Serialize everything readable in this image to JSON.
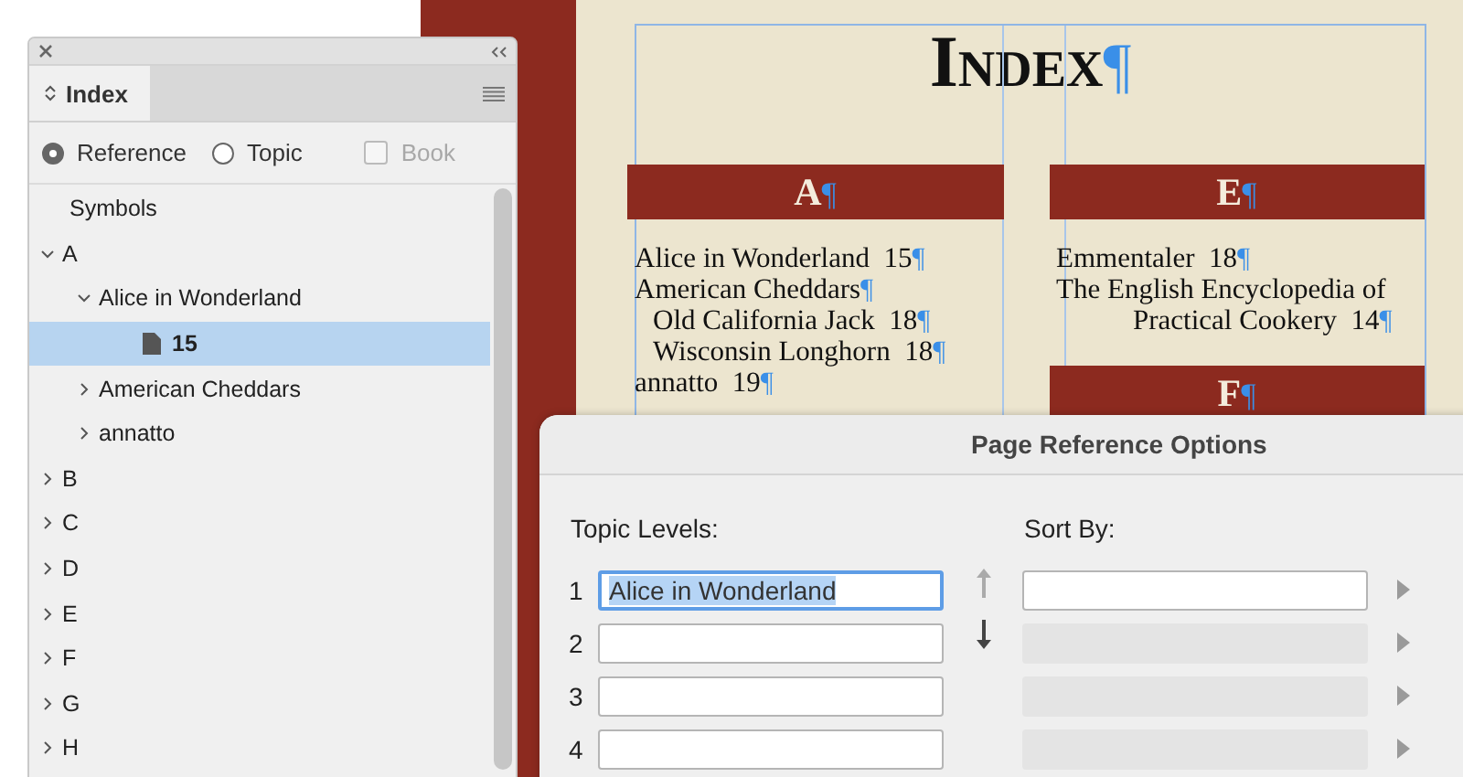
{
  "document": {
    "title": "Index",
    "pilcrow": "¶",
    "columns": [
      {
        "sections": [
          {
            "letter": "A",
            "entries": [
              {
                "text": "Alice in Wonderland",
                "page": "15"
              },
              {
                "text": "American Cheddars",
                "children": [
                  {
                    "text": "Old California Jack",
                    "page": "18"
                  },
                  {
                    "text": "Wisconsin Longhorn",
                    "page": "18"
                  }
                ]
              },
              {
                "text": "annatto",
                "page": "19"
              }
            ]
          }
        ]
      },
      {
        "sections": [
          {
            "letter": "E",
            "entries": [
              {
                "text": "Emmentaler",
                "page": "18"
              },
              {
                "text": "The English Encyclopedia of Practical Cookery",
                "page": "14"
              }
            ]
          },
          {
            "letter": "F"
          }
        ]
      }
    ]
  },
  "panel": {
    "title": "Index",
    "modes": [
      {
        "label": "Reference",
        "selected": true
      },
      {
        "label": "Topic",
        "selected": false
      }
    ],
    "book": {
      "label": "Book",
      "checked": false,
      "disabled": true
    },
    "tree": [
      {
        "label": "Symbols",
        "selected": false
      },
      {
        "label": "A",
        "expanded": true,
        "selected": false,
        "children": [
          {
            "label": "Alice in Wonderland",
            "expanded": true,
            "selected": false,
            "children": [
              {
                "label": "15",
                "kind": "page",
                "selected": true
              }
            ]
          },
          {
            "label": "American Cheddars",
            "expanded": false,
            "selected": false
          },
          {
            "label": "annatto",
            "expanded": false,
            "selected": false
          }
        ]
      },
      {
        "label": "B",
        "expanded": false,
        "selected": false
      },
      {
        "label": "C",
        "expanded": false,
        "selected": false
      },
      {
        "label": "D",
        "expanded": false,
        "selected": false
      },
      {
        "label": "E",
        "expanded": false,
        "selected": false
      },
      {
        "label": "F",
        "expanded": false,
        "selected": false
      },
      {
        "label": "G",
        "expanded": false,
        "selected": false
      },
      {
        "label": "H",
        "expanded": false,
        "selected": false
      }
    ]
  },
  "dialog": {
    "title": "Page Reference Options",
    "topic_levels_label": "Topic Levels:",
    "sort_by_label": "Sort By:",
    "topic_levels": [
      {
        "number": "1",
        "value": "Alice in Wonderland",
        "focused": true
      },
      {
        "number": "2",
        "focused": false
      },
      {
        "number": "3",
        "focused": false
      },
      {
        "number": "4",
        "focused": false
      }
    ],
    "move_up": {
      "disabled": true
    },
    "move_down": {
      "disabled": false
    },
    "sort_by": [
      {
        "disabled": false
      },
      {
        "disabled": true
      },
      {
        "disabled": true
      },
      {
        "disabled": true
      }
    ]
  }
}
